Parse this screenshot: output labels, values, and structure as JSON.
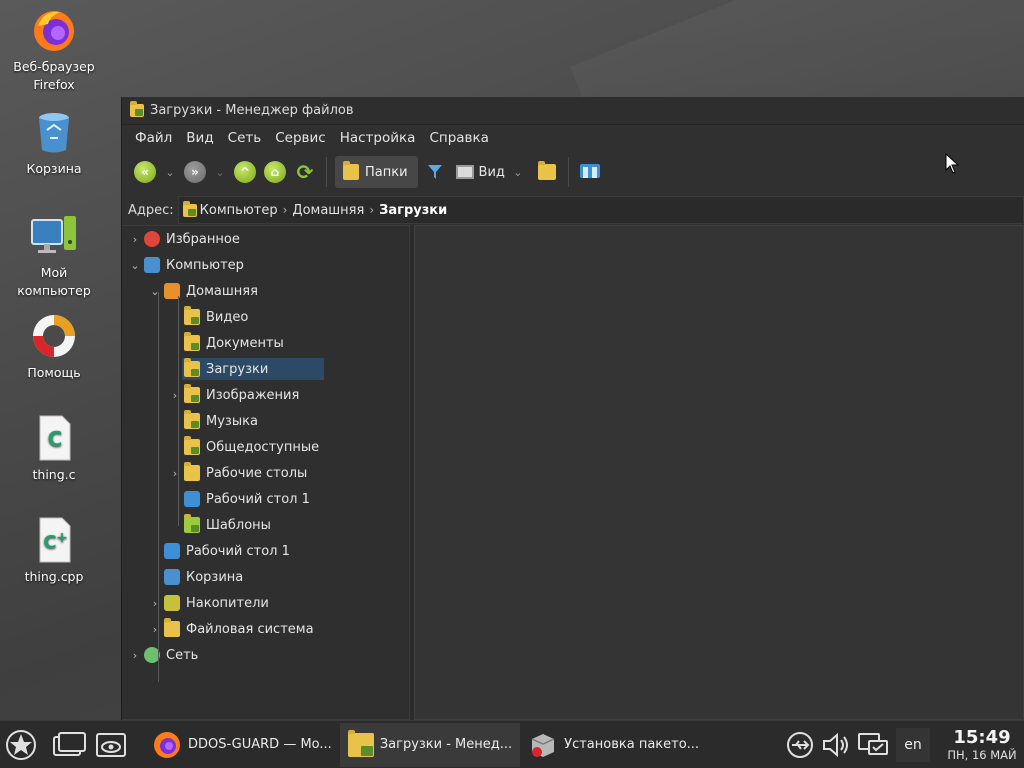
{
  "desktop": {
    "icons": [
      {
        "label": "Веб-браузер Firefox",
        "icon": "firefox-icon"
      },
      {
        "label": "Корзина",
        "icon": "trash-icon"
      },
      {
        "label": "Мой компьютер",
        "icon": "computer-icon"
      },
      {
        "label": "Помощь",
        "icon": "lifebuoy-icon"
      },
      {
        "label": "thing.c",
        "icon": "c-file-icon"
      },
      {
        "label": "thing.cpp",
        "icon": "cpp-file-icon"
      }
    ]
  },
  "window": {
    "title": "Загрузки - Менеджер файлов",
    "menu": [
      "Файл",
      "Вид",
      "Сеть",
      "Сервис",
      "Настройка",
      "Справка"
    ],
    "toolbar": {
      "folders_label": "Папки",
      "view_label": "Вид"
    },
    "address": {
      "label": "Адрес:",
      "crumbs": [
        "Компьютер",
        "Домашняя"
      ],
      "current": "Загрузки"
    },
    "tree": [
      {
        "label": "Избранное",
        "icon": "favorites-heart-icon",
        "level": 0,
        "expander": "collapsed"
      },
      {
        "label": "Компьютер",
        "icon": "computer-icon",
        "level": 0,
        "expander": "expanded"
      },
      {
        "label": "Домашняя",
        "icon": "home-folder-icon",
        "level": 1,
        "expander": "expanded"
      },
      {
        "label": "Видео",
        "icon": "video-folder-icon",
        "level": 2,
        "expander": "none"
      },
      {
        "label": "Документы",
        "icon": "documents-folder-icon",
        "level": 2,
        "expander": "none"
      },
      {
        "label": "Загрузки",
        "icon": "downloads-folder-icon",
        "level": 2,
        "expander": "none",
        "selected": true
      },
      {
        "label": "Изображения",
        "icon": "pictures-folder-icon",
        "level": 2,
        "expander": "collapsed"
      },
      {
        "label": "Музыка",
        "icon": "music-folder-icon",
        "level": 2,
        "expander": "none"
      },
      {
        "label": "Общедоступные",
        "icon": "public-folder-icon",
        "level": 2,
        "expander": "none"
      },
      {
        "label": "Рабочие столы",
        "icon": "folder-icon",
        "level": 2,
        "expander": "collapsed"
      },
      {
        "label": "Рабочий стол 1",
        "icon": "desktop-shortcut-icon",
        "level": 2,
        "expander": "none"
      },
      {
        "label": "Шаблоны",
        "icon": "templates-folder-icon",
        "level": 2,
        "expander": "none"
      },
      {
        "label": "Рабочий стол 1",
        "icon": "desktop-icon",
        "level": 1,
        "expander": "none"
      },
      {
        "label": "Корзина",
        "icon": "trash-icon",
        "level": 1,
        "expander": "none"
      },
      {
        "label": "Накопители",
        "icon": "drives-icon",
        "level": 1,
        "expander": "collapsed"
      },
      {
        "label": "Файловая система",
        "icon": "folder-icon",
        "level": 1,
        "expander": "collapsed"
      },
      {
        "label": "Сеть",
        "icon": "network-globe-icon",
        "level": 0,
        "expander": "collapsed"
      }
    ]
  },
  "taskbar": {
    "tasks": [
      {
        "label": "DDOS-GUARD — Mo...",
        "icon": "firefox-icon"
      },
      {
        "label": "Загрузки - Менед...",
        "icon": "downloads-folder-icon"
      },
      {
        "label": "Установка пакето...",
        "icon": "package-installer-icon"
      }
    ],
    "lang": "en",
    "time": "15:49",
    "date": "ПН, 16 МАЙ"
  },
  "colors": {
    "selection": "#2c4a66",
    "accent_green": "#79a818",
    "folder_yellow": "#e9c24a"
  }
}
